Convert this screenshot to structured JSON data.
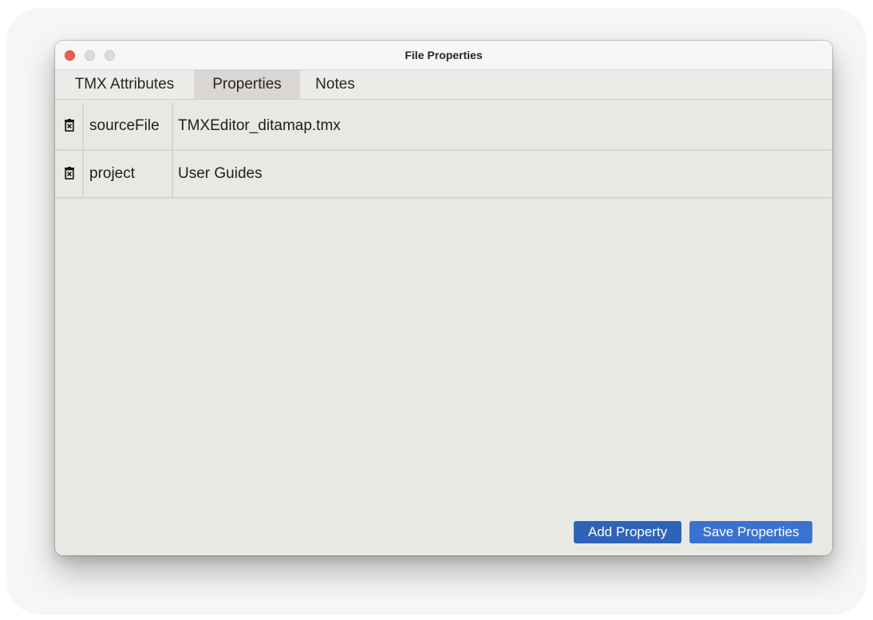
{
  "window": {
    "title": "File Properties"
  },
  "tabs": [
    {
      "label": "TMX Attributes",
      "selected": false
    },
    {
      "label": "Properties",
      "selected": true
    },
    {
      "label": "Notes",
      "selected": false
    }
  ],
  "properties": [
    {
      "key": "sourceFile",
      "value": "TMXEditor_ditamap.tmx",
      "delete_icon": "trash-icon"
    },
    {
      "key": "project",
      "value": "User Guides",
      "delete_icon": "trash-icon"
    }
  ],
  "buttons": {
    "add_label": "Add Property",
    "save_label": "Save Properties"
  },
  "colors": {
    "accent": "#3a72cf",
    "close": "#ee5d55"
  }
}
